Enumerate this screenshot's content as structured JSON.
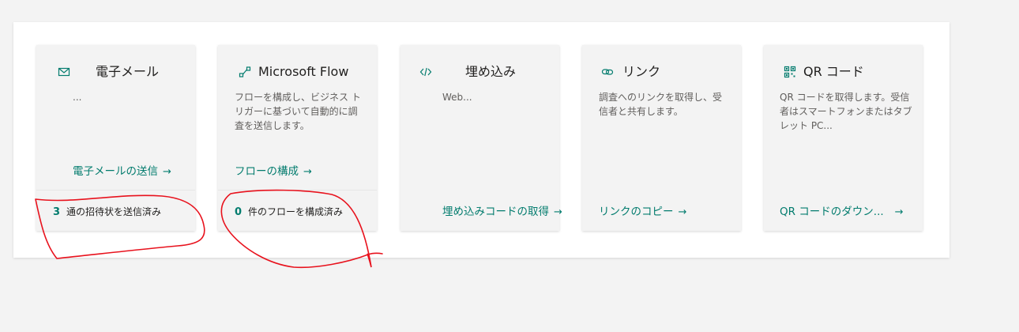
{
  "colors": {
    "accent": "#037c6e",
    "annotation": "#e8121d"
  },
  "cards": [
    {
      "icon": "mail-icon",
      "title": "電子メール",
      "description": "...",
      "action": "電子メールの送信",
      "stat_count": "3",
      "stat_label": "通の招待状を送信済み"
    },
    {
      "icon": "flow-icon",
      "title": "Microsoft Flow",
      "description": "フローを構成し、ビジネス トリガーに基づいて自動的に調査を送信します。",
      "action": "フローの構成",
      "stat_count": "0",
      "stat_label": "件のフローを構成済み"
    },
    {
      "icon": "embed-code-icon",
      "title": "埋め込み",
      "description": "Web...",
      "action": "埋め込みコードの取得"
    },
    {
      "icon": "link-icon",
      "title": "リンク",
      "description": "調査へのリンクを取得し、受信者と共有します。",
      "action": "リンクのコピー"
    },
    {
      "icon": "qr-code-icon",
      "title": "QR コード",
      "description": "QR コードを取得します。受信者はスマートフォンまたはタブレット PC...",
      "action": "QR コードのダウン..."
    }
  ]
}
